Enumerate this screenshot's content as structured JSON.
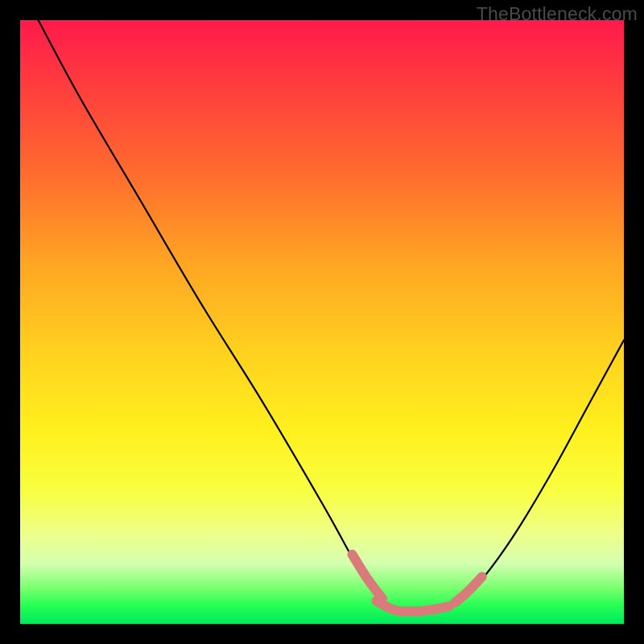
{
  "watermark": "TheBottleneck.com",
  "chart_data": {
    "type": "line",
    "title": "",
    "xlabel": "",
    "ylabel": "",
    "xlim": [
      0,
      100
    ],
    "ylim": [
      0,
      100
    ],
    "series": [
      {
        "name": "bottleneck-curve",
        "x": [
          3,
          10,
          20,
          30,
          40,
          50,
          55,
          58,
          60,
          63,
          67,
          70,
          73,
          77,
          82,
          88,
          94,
          100
        ],
        "y": [
          100,
          87,
          70,
          53,
          37,
          20,
          11,
          6,
          3.5,
          2,
          2,
          2.3,
          3.8,
          8,
          15,
          25,
          36,
          47
        ]
      }
    ],
    "highlight_segments": [
      {
        "name": "left-arm-tip",
        "x": [
          55,
          57.5,
          60
        ],
        "y": [
          11.5,
          7.5,
          4.2
        ]
      },
      {
        "name": "basin",
        "x": [
          59,
          62,
          65,
          68,
          71
        ],
        "y": [
          3.8,
          2.3,
          2.1,
          2.3,
          2.9
        ]
      },
      {
        "name": "right-arm-tip",
        "x": [
          72,
          74,
          76.5
        ],
        "y": [
          3.5,
          5.2,
          7.8
        ]
      }
    ],
    "colors": {
      "curve": "#000000",
      "highlight": "#d97b7b"
    }
  }
}
